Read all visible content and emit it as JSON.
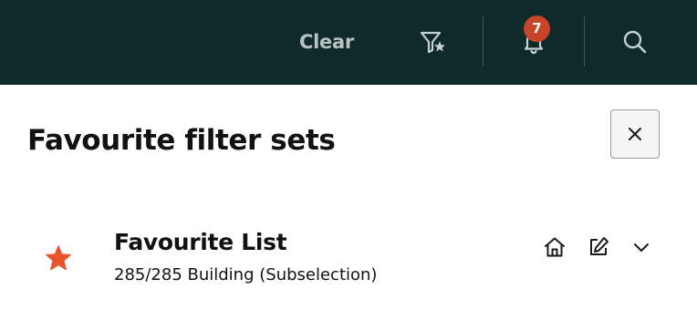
{
  "topbar": {
    "clear_label": "Clear",
    "notification_count": "7",
    "icons": [
      "filter-star-icon",
      "bell-icon",
      "search-icon"
    ],
    "background_color": "#0f2a2a",
    "badge_color": "#c5442a"
  },
  "panel": {
    "title": "Favourite filter sets",
    "close_icon": "close-icon"
  },
  "favourites": [
    {
      "name": "Favourite List",
      "subtitle": "285/285 Building (Subselection)",
      "star_color": "#e8552d",
      "actions": [
        "home-icon",
        "edit-icon",
        "chevron-down-icon"
      ]
    }
  ]
}
